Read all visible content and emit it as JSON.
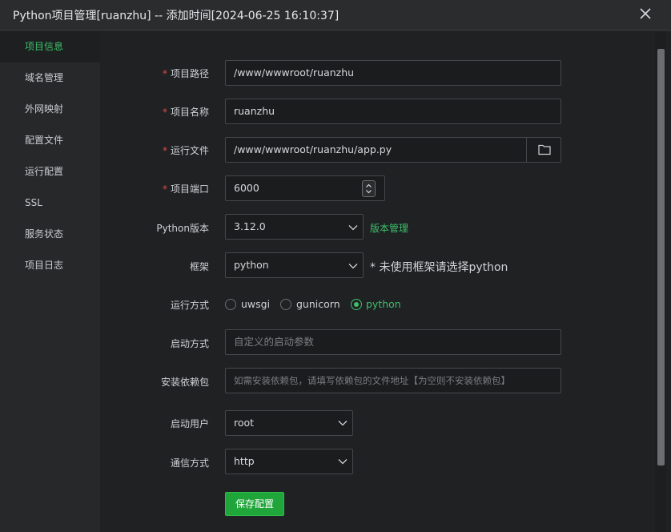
{
  "dialog": {
    "title": "Python项目管理[ruanzhu] -- 添加时间[2024-06-25 16:10:37]",
    "close_icon": "close-icon"
  },
  "sidebar": {
    "items": [
      {
        "label": "项目信息",
        "active": true
      },
      {
        "label": "域名管理",
        "active": false
      },
      {
        "label": "外网映射",
        "active": false
      },
      {
        "label": "配置文件",
        "active": false
      },
      {
        "label": "运行配置",
        "active": false
      },
      {
        "label": "SSL",
        "active": false
      },
      {
        "label": "服务状态",
        "active": false
      },
      {
        "label": "项目日志",
        "active": false
      }
    ]
  },
  "form": {
    "path": {
      "required_mark": "*",
      "label": "项目路径",
      "value": "/www/wwwroot/ruanzhu"
    },
    "name": {
      "required_mark": "*",
      "label": "项目名称",
      "value": "ruanzhu"
    },
    "run_file": {
      "required_mark": "*",
      "label": "运行文件",
      "value": "/www/wwwroot/ruanzhu/app.py",
      "icon": "folder-icon"
    },
    "port": {
      "required_mark": "*",
      "label": "项目端口",
      "value": "6000"
    },
    "python_version": {
      "label": "Python版本",
      "value": "3.12.0",
      "link": "版本管理"
    },
    "framework": {
      "label": "框架",
      "value": "python",
      "hint": "* 未使用框架请选择python"
    },
    "run_mode": {
      "label": "运行方式",
      "options": [
        {
          "label": "uwsgi",
          "selected": false
        },
        {
          "label": "gunicorn",
          "selected": false
        },
        {
          "label": "python",
          "selected": true
        }
      ]
    },
    "start_args": {
      "label": "启动方式",
      "placeholder": "自定义的启动参数"
    },
    "dependencies": {
      "label": "安装依赖包",
      "placeholder": "如需安装依赖包，请填写依赖包的文件地址【为空则不安装依赖包】"
    },
    "start_user": {
      "label": "启动用户",
      "value": "root"
    },
    "protocol": {
      "label": "通信方式",
      "value": "http"
    },
    "save_label": "保存配置"
  },
  "colors": {
    "accent": "#3fbf6a",
    "button": "#20a53a",
    "required": "#e04a4a",
    "background": "#1f2123"
  }
}
